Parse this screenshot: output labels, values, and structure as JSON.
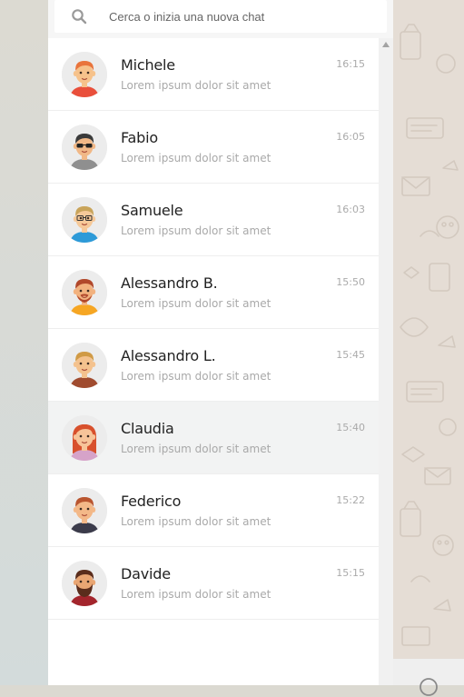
{
  "search": {
    "placeholder": "Cerca o inizia una nuova chat",
    "icon": "search-icon"
  },
  "chats": [
    {
      "name": "Michele",
      "preview": "Lorem ipsum dolor sit amet",
      "time": "16:15",
      "active": false,
      "avatar": {
        "hair": "#e9743c",
        "skin": "#f6c28b",
        "shirt": "#e94f3b",
        "accessory": "none"
      }
    },
    {
      "name": "Fabio",
      "preview": "Lorem ipsum dolor sit amet",
      "time": "16:05",
      "active": false,
      "avatar": {
        "hair": "#3a3a3a",
        "skin": "#f1b887",
        "shirt": "#8f8f8f",
        "accessory": "sunglasses"
      }
    },
    {
      "name": "Samuele",
      "preview": "Lorem ipsum dolor sit amet",
      "time": "16:03",
      "active": false,
      "avatar": {
        "hair": "#c9a45a",
        "skin": "#f6c999",
        "shirt": "#2d9ad8",
        "accessory": "glasses"
      }
    },
    {
      "name": "Alessandro B.",
      "preview": "Lorem ipsum dolor sit amet",
      "time": "15:50",
      "active": false,
      "avatar": {
        "hair": "#b1482b",
        "skin": "#f2b27f",
        "shirt": "#f6a623",
        "accessory": "beard"
      }
    },
    {
      "name": "Alessandro L.",
      "preview": "Lorem ipsum dolor sit amet",
      "time": "15:45",
      "active": false,
      "avatar": {
        "hair": "#d09a45",
        "skin": "#f4c28e",
        "shirt": "#a04b2f",
        "accessory": "none"
      }
    },
    {
      "name": "Claudia",
      "preview": "Lorem ipsum dolor sit amet",
      "time": "15:40",
      "active": true,
      "avatar": {
        "hair": "#d8502c",
        "skin": "#f7c499",
        "shirt": "#d6a3c9",
        "accessory": "longhair"
      }
    },
    {
      "name": "Federico",
      "preview": "Lorem ipsum dolor sit amet",
      "time": "15:22",
      "active": false,
      "avatar": {
        "hair": "#b9552f",
        "skin": "#f3b888",
        "shirt": "#3b3b4a",
        "accessory": "none"
      }
    },
    {
      "name": "Davide",
      "preview": "Lorem ipsum dolor sit amet",
      "time": "15:15",
      "active": false,
      "avatar": {
        "hair": "#5a2d1c",
        "skin": "#e9a673",
        "shirt": "#a3252c",
        "accessory": "fullbeard"
      }
    }
  ],
  "colors": {
    "panel": "#ffffff",
    "active_row": "#f2f3f3",
    "name": "#222222",
    "preview": "#a9a9a9",
    "time": "#aaaaaa",
    "wallpaper": "#e5ddd5"
  },
  "footer": {
    "icon": "emoji-icon"
  }
}
